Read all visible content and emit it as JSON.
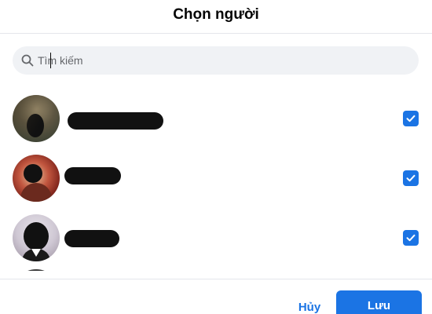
{
  "dialog": {
    "title": "Chọn người"
  },
  "search": {
    "placeholder": "Tìm kiếm",
    "value": ""
  },
  "people": [
    {
      "name": "",
      "name_redacted": true,
      "selected": true
    },
    {
      "name": "",
      "name_redacted": true,
      "selected": true
    },
    {
      "name": "",
      "name_redacted": true,
      "selected": true
    }
  ],
  "actions": {
    "cancel_label": "Hủy",
    "save_label": "Lưu"
  },
  "colors": {
    "accent": "#1b74e4",
    "search_bg": "#f0f2f5",
    "divider": "#e4e6eb"
  },
  "icons": {
    "search": "search-icon",
    "checkbox": "checkmark-icon"
  }
}
